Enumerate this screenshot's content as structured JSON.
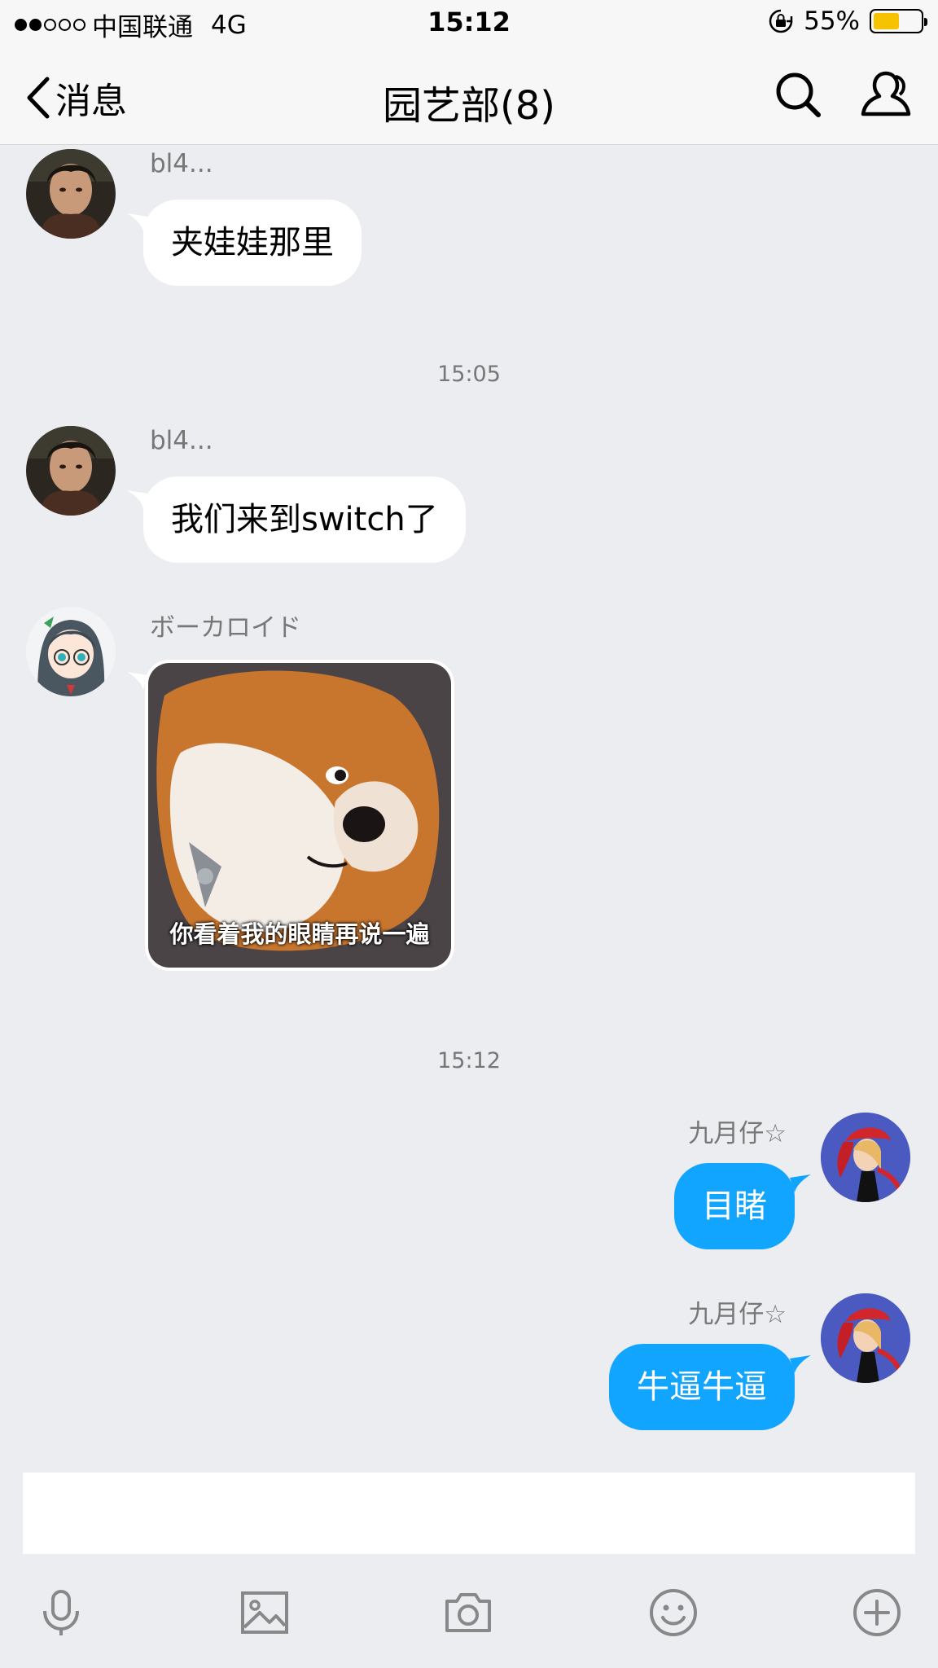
{
  "status_bar": {
    "signal_dots_filled": 2,
    "signal_dots_total": 5,
    "carrier": "中国联通",
    "network": "4G",
    "time": "15:12",
    "battery_percent": "55%",
    "battery_level": 0.55,
    "battery_color": "#f7c300"
  },
  "nav": {
    "back_label": "消息",
    "title": "园艺部(8)"
  },
  "messages": [
    {
      "sender": "bl4...",
      "text": "夹娃娃那里",
      "direction": "incoming"
    },
    {
      "timestamp": "15:05"
    },
    {
      "sender": "bl4...",
      "text": "我们来到switch了",
      "direction": "incoming"
    },
    {
      "sender": "ボーカロイド",
      "sticker_caption": "你看着我的眼睛再说一遍",
      "direction": "incoming"
    },
    {
      "timestamp": "15:12"
    },
    {
      "sender": "九月仔☆",
      "text": "目睹",
      "direction": "outgoing"
    },
    {
      "sender": "九月仔☆",
      "text": "牛逼牛逼",
      "direction": "outgoing"
    }
  ],
  "toolbar": {
    "icons": [
      "microphone-icon",
      "image-icon",
      "camera-icon",
      "emoji-icon",
      "plus-icon"
    ]
  },
  "colors": {
    "background": "#ecedf1",
    "outgoing_bubble": "#12a5ff",
    "incoming_bubble": "#ffffff"
  }
}
